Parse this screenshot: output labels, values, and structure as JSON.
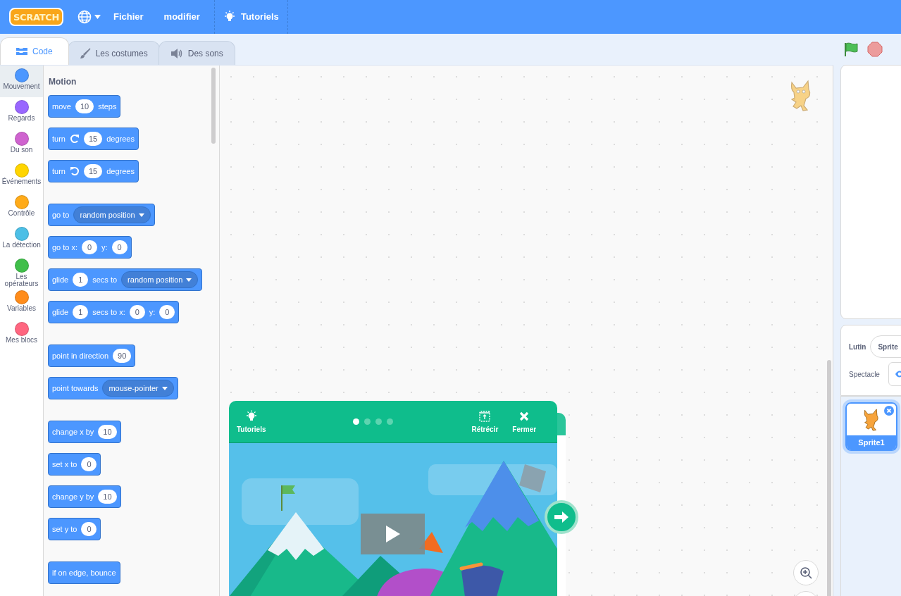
{
  "menu_bar": {
    "logo": "SCRATCH",
    "items": [
      {
        "label": "Fichier"
      },
      {
        "label": "modifier"
      }
    ],
    "tutorials": "Tutoriels"
  },
  "tabs": [
    {
      "label": "Code",
      "selected": true
    },
    {
      "label": "Les costumes",
      "selected": false
    },
    {
      "label": "Des sons",
      "selected": false
    }
  ],
  "categories": [
    {
      "label": "Mouvement",
      "color": "#4c97ff",
      "selected": true
    },
    {
      "label": "Regards",
      "color": "#9966ff",
      "selected": false
    },
    {
      "label": "Du son",
      "color": "#cf63cf",
      "selected": false
    },
    {
      "label": "Événements",
      "color": "#ffd500",
      "selected": false
    },
    {
      "label": "Contrôle",
      "color": "#ffab19",
      "selected": false
    },
    {
      "label": "La détection",
      "color": "#4cbfe6",
      "selected": false
    },
    {
      "label": "Les opérateurs",
      "color": "#40bf4a",
      "selected": false
    },
    {
      "label": "Variables",
      "color": "#ff8c1a",
      "selected": false
    },
    {
      "label": "Mes blocs",
      "color": "#ff6680",
      "selected": false
    }
  ],
  "palette": {
    "title": "Motion",
    "groups": [
      [
        {
          "parts": [
            {
              "kind": "label",
              "text": "move"
            },
            {
              "kind": "number",
              "text": "10"
            },
            {
              "kind": "label",
              "text": "steps"
            }
          ]
        },
        {
          "parts": [
            {
              "kind": "label",
              "text": "turn"
            },
            {
              "kind": "rotate-right"
            },
            {
              "kind": "number",
              "text": "15"
            },
            {
              "kind": "label",
              "text": "degrees"
            }
          ]
        },
        {
          "parts": [
            {
              "kind": "label",
              "text": "turn"
            },
            {
              "kind": "rotate-left"
            },
            {
              "kind": "number",
              "text": "15"
            },
            {
              "kind": "label",
              "text": "degrees"
            }
          ]
        }
      ],
      [
        {
          "parts": [
            {
              "kind": "label",
              "text": "go to"
            },
            {
              "kind": "dropdown",
              "text": "random position"
            }
          ]
        },
        {
          "parts": [
            {
              "kind": "label",
              "text": "go to x:"
            },
            {
              "kind": "number",
              "text": "0"
            },
            {
              "kind": "label",
              "text": "y:"
            },
            {
              "kind": "number",
              "text": "0"
            }
          ]
        },
        {
          "parts": [
            {
              "kind": "label",
              "text": "glide"
            },
            {
              "kind": "number",
              "text": "1"
            },
            {
              "kind": "label",
              "text": "secs to"
            },
            {
              "kind": "dropdown",
              "text": "random position"
            }
          ]
        },
        {
          "parts": [
            {
              "kind": "label",
              "text": "glide"
            },
            {
              "kind": "number",
              "text": "1"
            },
            {
              "kind": "label",
              "text": "secs to x:"
            },
            {
              "kind": "number",
              "text": "0"
            },
            {
              "kind": "label",
              "text": "y:"
            },
            {
              "kind": "number",
              "text": "0"
            }
          ]
        }
      ],
      [
        {
          "parts": [
            {
              "kind": "label",
              "text": "point in direction"
            },
            {
              "kind": "number",
              "text": "90"
            }
          ]
        },
        {
          "parts": [
            {
              "kind": "label",
              "text": "point towards"
            },
            {
              "kind": "dropdown",
              "text": "mouse-pointer"
            }
          ]
        }
      ],
      [
        {
          "parts": [
            {
              "kind": "label",
              "text": "change x by"
            },
            {
              "kind": "number",
              "text": "10"
            }
          ]
        },
        {
          "parts": [
            {
              "kind": "label",
              "text": "set x to"
            },
            {
              "kind": "number",
              "text": "0"
            }
          ]
        },
        {
          "parts": [
            {
              "kind": "label",
              "text": "change y by"
            },
            {
              "kind": "number",
              "text": "10"
            }
          ]
        },
        {
          "parts": [
            {
              "kind": "label",
              "text": "set y to"
            },
            {
              "kind": "number",
              "text": "0"
            }
          ]
        }
      ],
      [
        {
          "parts": [
            {
              "kind": "label",
              "text": "if on edge, bounce"
            }
          ]
        }
      ]
    ]
  },
  "tutorial": {
    "title": "Tutoriels",
    "steps": [
      {
        "selected": true
      },
      {
        "selected": false
      },
      {
        "selected": false
      },
      {
        "selected": false
      }
    ],
    "shrink": "Rétrécir",
    "close": "Fermer"
  },
  "sprite_info": {
    "sprite_label": "Lutin",
    "sprite_name": "Sprite",
    "show_label": "Spectacle"
  },
  "sprites": [
    {
      "name": "Sprite1",
      "selected": true
    }
  ]
}
